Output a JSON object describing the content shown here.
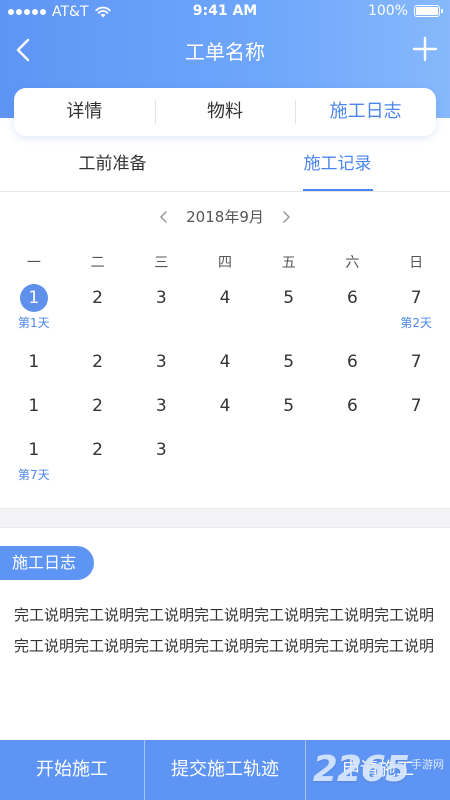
{
  "status_bar": {
    "carrier": "AT&T",
    "time": "9:41 AM",
    "battery": "100%"
  },
  "nav": {
    "title": "工单名称"
  },
  "tabs": [
    {
      "label": "详情",
      "active": false
    },
    {
      "label": "物料",
      "active": false
    },
    {
      "label": "施工日志",
      "active": true
    }
  ],
  "subtabs": [
    {
      "label": "工前准备",
      "active": false
    },
    {
      "label": "施工记录",
      "active": true
    }
  ],
  "calendar": {
    "month_label": "2018年9月",
    "weekdays": [
      "一",
      "二",
      "三",
      "四",
      "五",
      "六",
      "日"
    ],
    "rows": [
      [
        {
          "d": "1",
          "label": "第1天",
          "selected": true
        },
        {
          "d": "2"
        },
        {
          "d": "3"
        },
        {
          "d": "4"
        },
        {
          "d": "5"
        },
        {
          "d": "6"
        },
        {
          "d": "7",
          "label": "第2天"
        }
      ],
      [
        {
          "d": "1"
        },
        {
          "d": "2"
        },
        {
          "d": "3"
        },
        {
          "d": "4"
        },
        {
          "d": "5"
        },
        {
          "d": "6"
        },
        {
          "d": "7"
        }
      ],
      [
        {
          "d": "1"
        },
        {
          "d": "2"
        },
        {
          "d": "3"
        },
        {
          "d": "4"
        },
        {
          "d": "5"
        },
        {
          "d": "6"
        },
        {
          "d": "7"
        }
      ],
      [
        {
          "d": "1",
          "label": "第7天"
        },
        {
          "d": "2"
        },
        {
          "d": "3"
        }
      ]
    ]
  },
  "log": {
    "title": "施工日志",
    "text": "完工说明完工说明完工说明完工说明完工说明完工说明完工说明完工说明完工说明完工说明完工说明完工说明完工说明完工说明"
  },
  "actions": {
    "start": "开始施工",
    "submit_track": "提交施工轨迹",
    "apply": "申请施工"
  },
  "watermark": {
    "big": "2265",
    "small": "手游网"
  },
  "colors": {
    "primary": "#5e95f5",
    "accent_text": "#4b86ee"
  }
}
